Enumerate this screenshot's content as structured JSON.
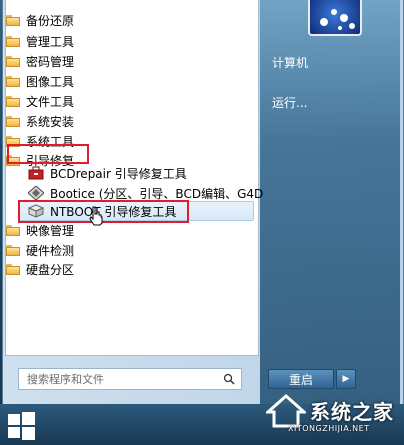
{
  "menu": {
    "folders_top": [
      "备份还原",
      "管理工具",
      "密码管理",
      "图像工具",
      "文件工具",
      "系统安装",
      "系统工具",
      "引导修复"
    ],
    "subitems": [
      {
        "label": "BCDrepair 引导修复工具",
        "icon": "toolbox-icon"
      },
      {
        "label": "Bootice (分区、引导、BCD编辑、G4D",
        "icon": "diamond-tool-icon"
      },
      {
        "label": "NTBOOT 引导修复工具",
        "icon": "box-icon"
      }
    ],
    "folders_bottom": [
      "映像管理",
      "硬件检测",
      "硬盘分区"
    ]
  },
  "right": {
    "computer_label": "计算机",
    "run_label": "运行..."
  },
  "search": {
    "placeholder": "搜索程序和文件"
  },
  "shutdown": {
    "label": "重启",
    "arrow": "▶"
  },
  "watermark": {
    "title": "系统之家",
    "url": "XITONGZHIJIA.NET"
  },
  "colors": {
    "highlight": "#e01d2a",
    "accent": "#3c6d92"
  }
}
